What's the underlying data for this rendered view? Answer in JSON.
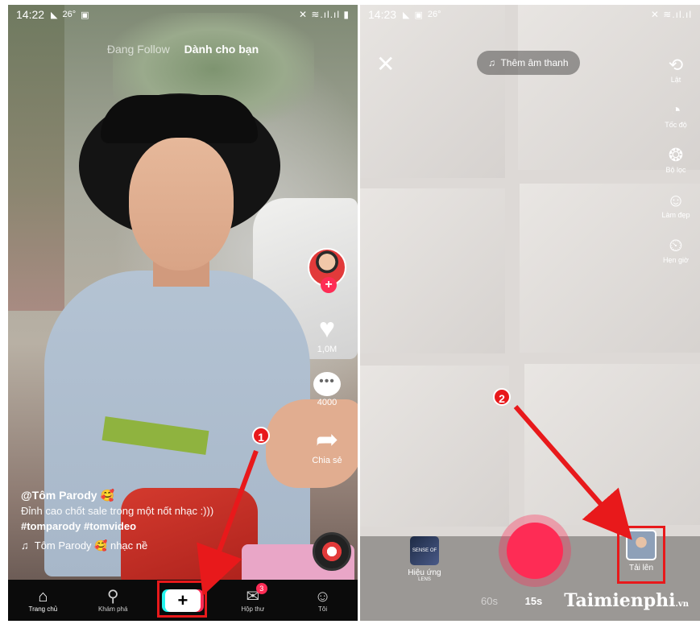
{
  "left": {
    "status": {
      "time": "14:22",
      "temp": "26°",
      "icons_right": "✕ ≋.ıl.ıl ▮"
    },
    "feed_tabs": {
      "following": "Đang Follow",
      "for_you": "Dành cho bạn"
    },
    "actions": {
      "likes": "1,0M",
      "comments": "4000",
      "share": "Chia sẻ"
    },
    "caption": {
      "user": "@Tôm Parody 🥰",
      "desc": "Đỉnh cao chốt sale trong một nốt nhạc :)))",
      "tags": "#tomparody #tomvideo",
      "music": "Tôm Parody 🥰 nhạc nề"
    },
    "nav": {
      "home": "Trang chủ",
      "discover": "Khám phá",
      "inbox": "Hộp thư",
      "inbox_badge": "3",
      "me": "Tôi"
    },
    "step": "1"
  },
  "right": {
    "status": {
      "time": "14:23",
      "temp": "26°",
      "icons_right": "✕ ≋.ıl.ıl"
    },
    "add_sound": "Thêm âm thanh",
    "tools": [
      {
        "icon": "flip-icon",
        "glyph": "⟲",
        "label": "Lật"
      },
      {
        "icon": "speed-icon",
        "glyph": "◔",
        "label": "Tốc độ"
      },
      {
        "icon": "filter-icon",
        "glyph": "❂",
        "label": "Bộ lọc"
      },
      {
        "icon": "beauty-icon",
        "glyph": "☺",
        "label": "Làm đẹp"
      },
      {
        "icon": "timer-icon",
        "glyph": "⏲",
        "label": "Hẹn giờ"
      }
    ],
    "effects": {
      "label": "Hiệu ứng",
      "thumb_text": "SENSE OF LENS"
    },
    "upload": {
      "label": "Tải lên"
    },
    "durations": {
      "d60": "60s",
      "d15": "15s"
    },
    "step": "2"
  },
  "watermark": {
    "brand": "Taimienphi",
    "tld": ".vn"
  },
  "colors": {
    "accent": "#fe2c55",
    "cyan": "#25f4ee",
    "highlight": "#e8191b"
  }
}
